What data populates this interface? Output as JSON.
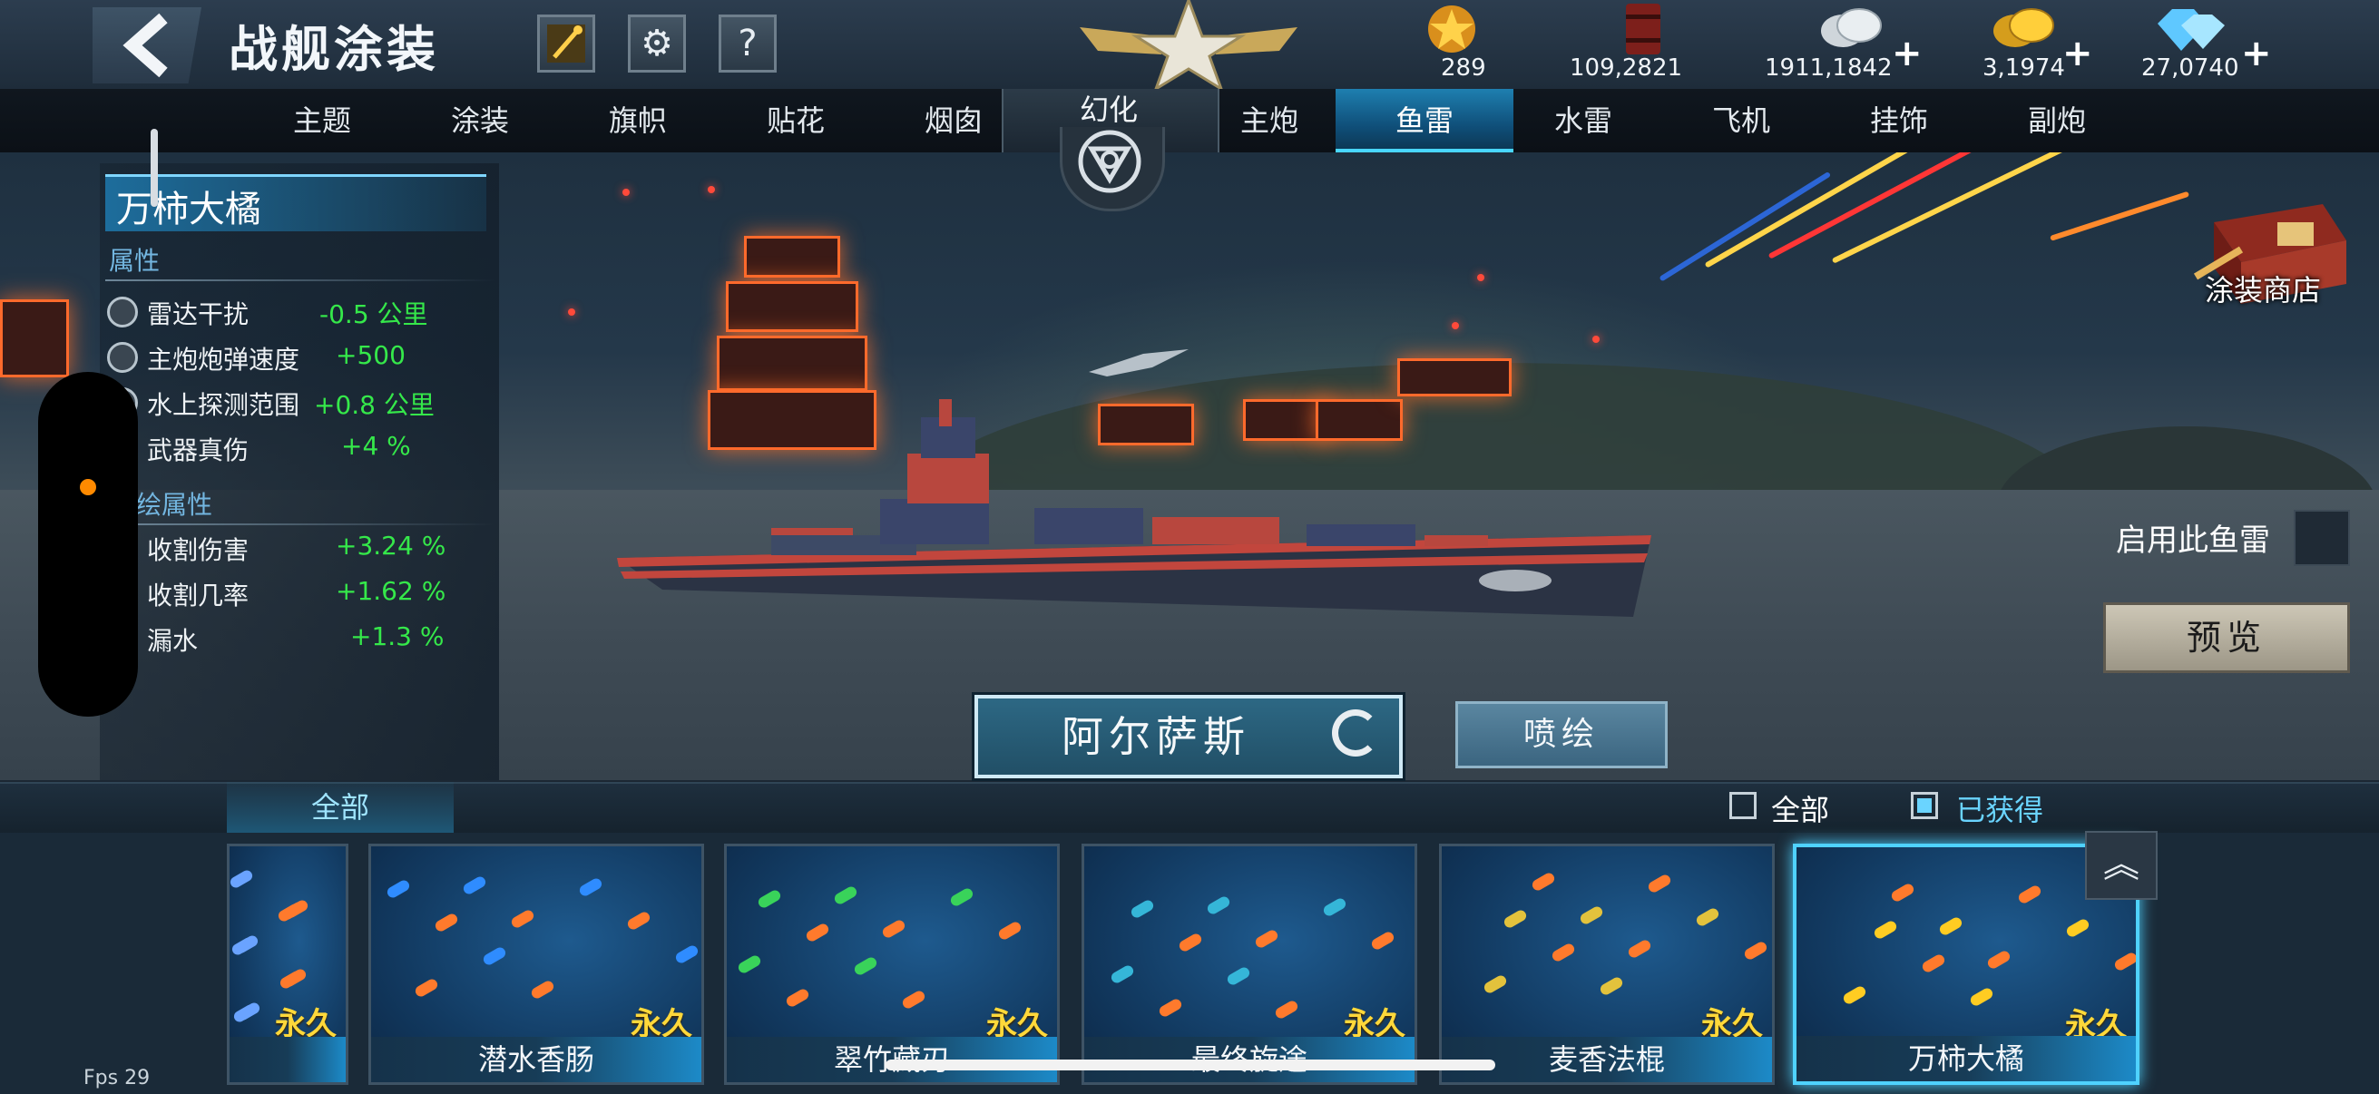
{
  "header": {
    "title": "战舰涂装",
    "resources": [
      {
        "icon": "star-medal-icon",
        "value": "289",
        "has_plus": false
      },
      {
        "icon": "oil-barrel-icon",
        "value": "109,2821",
        "has_plus": false
      },
      {
        "icon": "silver-coin-icon",
        "value": "1911,1842",
        "has_plus": true
      },
      {
        "icon": "gold-coin-icon",
        "value": "3,1974",
        "has_plus": true
      },
      {
        "icon": "diamond-icon",
        "value": "27,0740",
        "has_plus": true
      }
    ]
  },
  "tabs": {
    "left": [
      "主题",
      "涂装",
      "旗帜",
      "贴花",
      "烟囱"
    ],
    "phantom": "幻化",
    "right": [
      "主炮",
      "鱼雷",
      "水雷",
      "飞机",
      "挂饰",
      "副炮"
    ],
    "active": "鱼雷"
  },
  "stats": {
    "skin_name": "万柿大橘",
    "section1": "属性",
    "section2": "绘属性",
    "rows1": [
      {
        "name": "雷达干扰",
        "value": "-0.5 公里"
      },
      {
        "name": "主炮炮弹速度",
        "value": "+500"
      },
      {
        "name": "水上探测范围",
        "value": "+0.8 公里"
      },
      {
        "name": "武器真伤",
        "value": "+4 %"
      }
    ],
    "rows2": [
      {
        "name": "收割伤害",
        "value": "+3.24 %"
      },
      {
        "name": "收割几率",
        "value": "+1.62 %"
      },
      {
        "name": "漏水",
        "value": "+1.3 %"
      }
    ]
  },
  "right_panel": {
    "shop_label": "涂装商店",
    "use_label": "启用此鱼雷",
    "preview_label": "预览"
  },
  "center": {
    "ship_name": "阿尔萨斯",
    "spray_label": "喷绘"
  },
  "filter": {
    "tab": "全部",
    "check_all": "全部",
    "check_owned": "已获得",
    "owned_checked": true
  },
  "cards": [
    {
      "name": "",
      "tag": "永久",
      "theme": "#6aa3ff"
    },
    {
      "name": "潜水香肠",
      "tag": "永久",
      "theme": "#2f8cff"
    },
    {
      "name": "翠竹藏刃",
      "tag": "永久",
      "theme": "#39d35a"
    },
    {
      "name": "最终旋途",
      "tag": "永久",
      "theme": "#35b6d8"
    },
    {
      "name": "麦香法棍",
      "tag": "永久",
      "theme": "#e3c23c"
    },
    {
      "name": "万柿大橘",
      "tag": "永久",
      "theme": "#ffcc22",
      "selected": true
    }
  ],
  "footer": {
    "fps": "Fps 29"
  }
}
